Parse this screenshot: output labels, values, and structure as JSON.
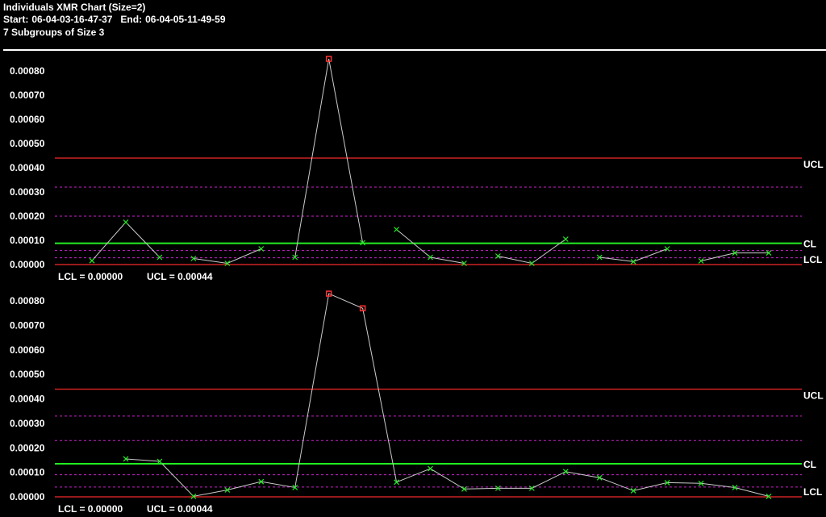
{
  "header": {
    "title": "Individuals XMR Chart (Size=2)",
    "start_label": "Start:",
    "start": "06-04-03-16-47-37",
    "end_label": "End:",
    "end": "06-04-05-11-49-59",
    "subgroups": "7 Subgroups of Size 3"
  },
  "colors": {
    "control_limit": "#cc2222",
    "center_line": "#22ee22",
    "sigma_line": "#cc22cc",
    "data_line": "#cccccc",
    "point_ok": "#22ee22",
    "point_out": "#ff3333"
  },
  "chart_data": [
    {
      "type": "line",
      "title": "",
      "xlabel": "",
      "ylabel": "",
      "ylim": [
        0,
        0.00085
      ],
      "y_ticks": [
        "0.00000",
        "0.00010",
        "0.00020",
        "0.00030",
        "0.00040",
        "0.00050",
        "0.00060",
        "0.00070",
        "0.00080"
      ],
      "limits": {
        "UCL": 0.00044,
        "CL": 8.8e-05,
        "LCL": 0.0
      },
      "sigma_lines": [
        0.00032,
        0.0002,
        5.8e-05,
        2.8e-05
      ],
      "limit_labels": {
        "ucl": "UCL",
        "cl": "CL",
        "lcl": "LCL"
      },
      "footer": {
        "lcl": "LCL = 0.00000",
        "ucl": "UCL = 0.00044"
      },
      "segments": [
        [
          1.6e-05,
          0.000175,
          3e-05
        ],
        [
          2.5e-05,
          5e-06,
          6.5e-05
        ],
        [
          3e-05,
          0.00085,
          9e-05
        ],
        [
          0.000145,
          3e-05,
          5e-06
        ],
        [
          3.5e-05,
          5e-06,
          0.000105
        ],
        [
          3e-05,
          1.2e-05,
          6.5e-05
        ],
        [
          1.5e-05,
          4.8e-05,
          4.8e-05
        ]
      ],
      "out_of_control": [
        [
          2,
          1
        ]
      ]
    },
    {
      "type": "line",
      "title": "",
      "xlabel": "",
      "ylabel": "",
      "ylim": [
        0,
        0.00085
      ],
      "y_ticks": [
        "0.00000",
        "0.00010",
        "0.00020",
        "0.00030",
        "0.00040",
        "0.00050",
        "0.00060",
        "0.00070",
        "0.00080"
      ],
      "limits": {
        "UCL": 0.00044,
        "CL": 0.000135,
        "LCL": 0.0
      },
      "sigma_lines": [
        0.00033,
        0.00023,
        9e-05,
        4e-05
      ],
      "limit_labels": {
        "ucl": "UCL",
        "cl": "CL",
        "lcl": "LCL"
      },
      "footer": {
        "lcl": "LCL = 0.00000",
        "ucl": "UCL = 0.00044"
      },
      "series": [
        0.000155,
        0.000145,
        2e-06,
        2.8e-05,
        6.2e-05,
        3.8e-05,
        0.00083,
        0.00077,
        6e-05,
        0.000115,
        3.2e-05,
        3.5e-05,
        3.5e-05,
        0.000103,
        7.8e-05,
        2.5e-05,
        5.8e-05,
        5.5e-05,
        3.8e-05,
        2e-06
      ],
      "out_of_control": [
        6,
        7
      ]
    }
  ]
}
